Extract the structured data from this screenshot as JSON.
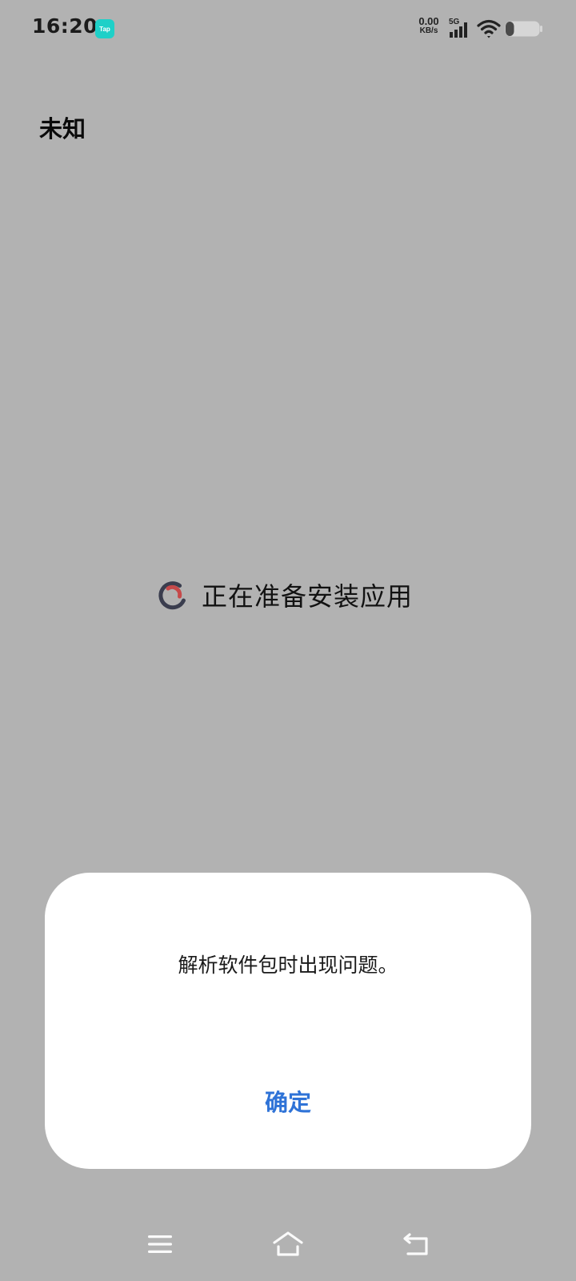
{
  "status_bar": {
    "time": "16:20",
    "app_badge": "Tap",
    "net_speed_value": "0.00",
    "net_speed_unit": "KB/s",
    "network_type": "5G",
    "battery_level": 0.25
  },
  "page": {
    "title": "未知",
    "status_text": "正在准备安装应用"
  },
  "dialog": {
    "message": "解析软件包时出现问题。",
    "ok_label": "确定"
  },
  "nav": {
    "menu_icon": "menu-icon",
    "home_icon": "home-icon",
    "back_icon": "back-icon"
  },
  "colors": {
    "background": "#b2b2b2",
    "accent": "#2f73d7",
    "spinner_red": "#c6494a",
    "spinner_dark": "#3a3d4e"
  }
}
